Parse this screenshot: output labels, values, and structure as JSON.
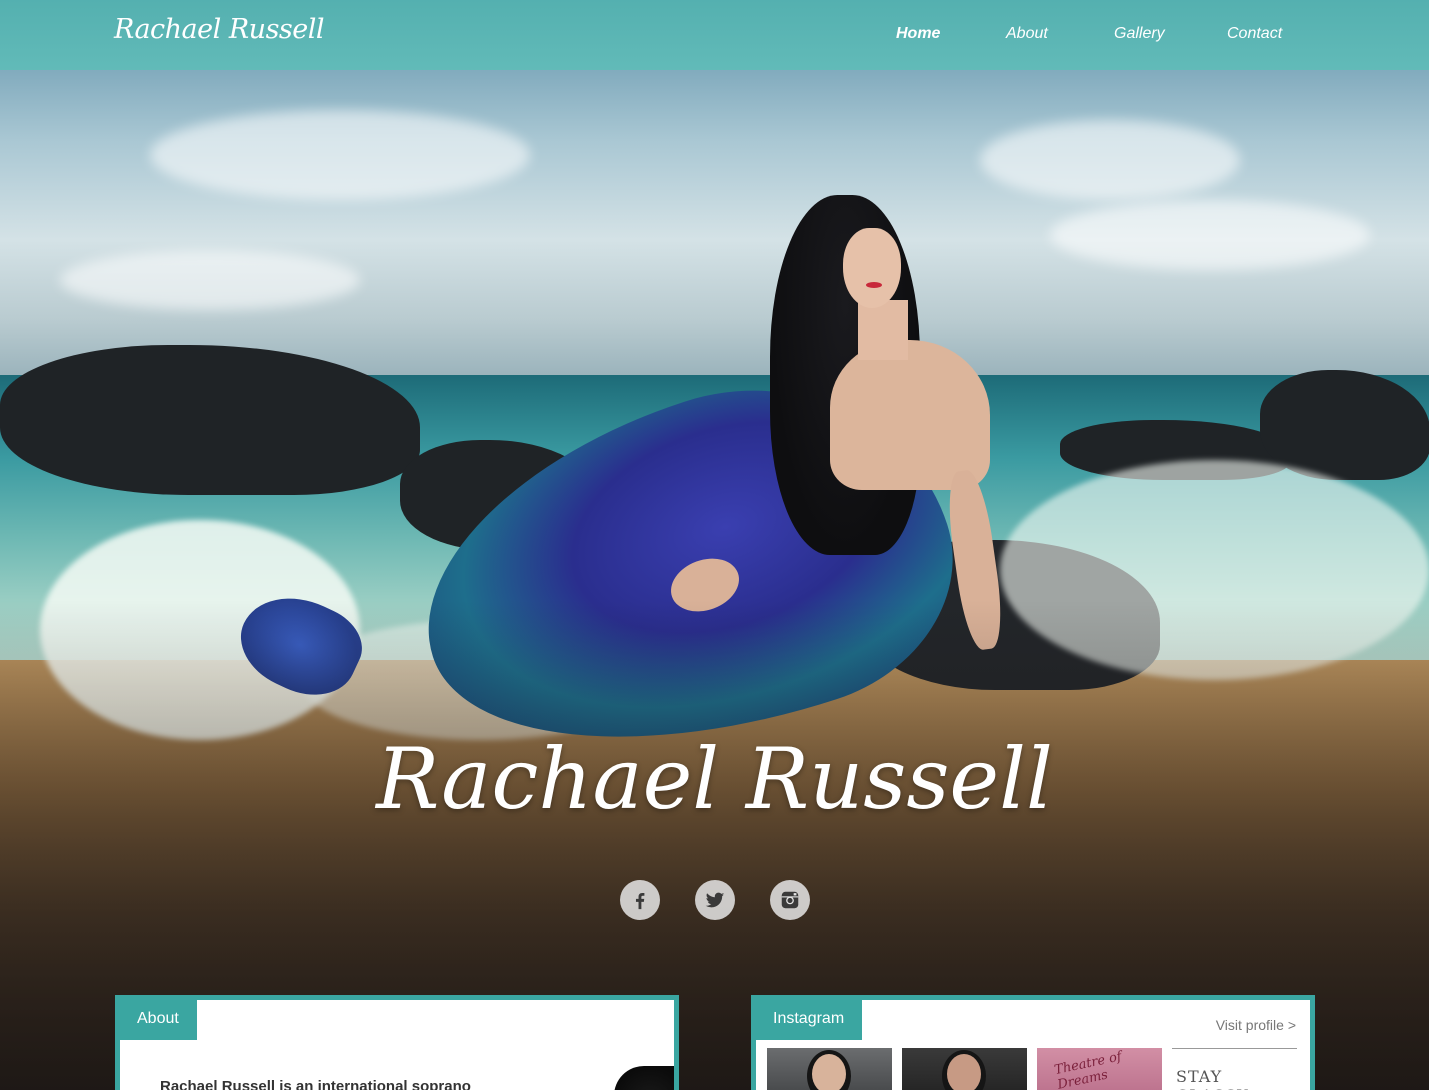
{
  "brand": "Rachael Russell",
  "nav": {
    "items": [
      {
        "label": "Home",
        "active": true
      },
      {
        "label": "About",
        "active": false
      },
      {
        "label": "Gallery",
        "active": false
      },
      {
        "label": "Contact",
        "active": false
      }
    ]
  },
  "hero": {
    "title": "Rachael Russell",
    "socials": [
      "facebook-icon",
      "twitter-icon",
      "instagram-icon"
    ]
  },
  "about": {
    "tab": "About",
    "text": "Rachael Russell is an international soprano"
  },
  "instagram": {
    "tab": "Instagram",
    "visit_link": "Visit profile >",
    "thumbs": [
      {
        "text": ""
      },
      {
        "text": ""
      },
      {
        "text": "Theatre of Dreams"
      },
      {
        "text": "STAY CLASSY"
      }
    ]
  },
  "colors": {
    "accent": "#3aa6a1",
    "nav_bg": "#5bb8b4",
    "text_white": "#ffffff"
  }
}
